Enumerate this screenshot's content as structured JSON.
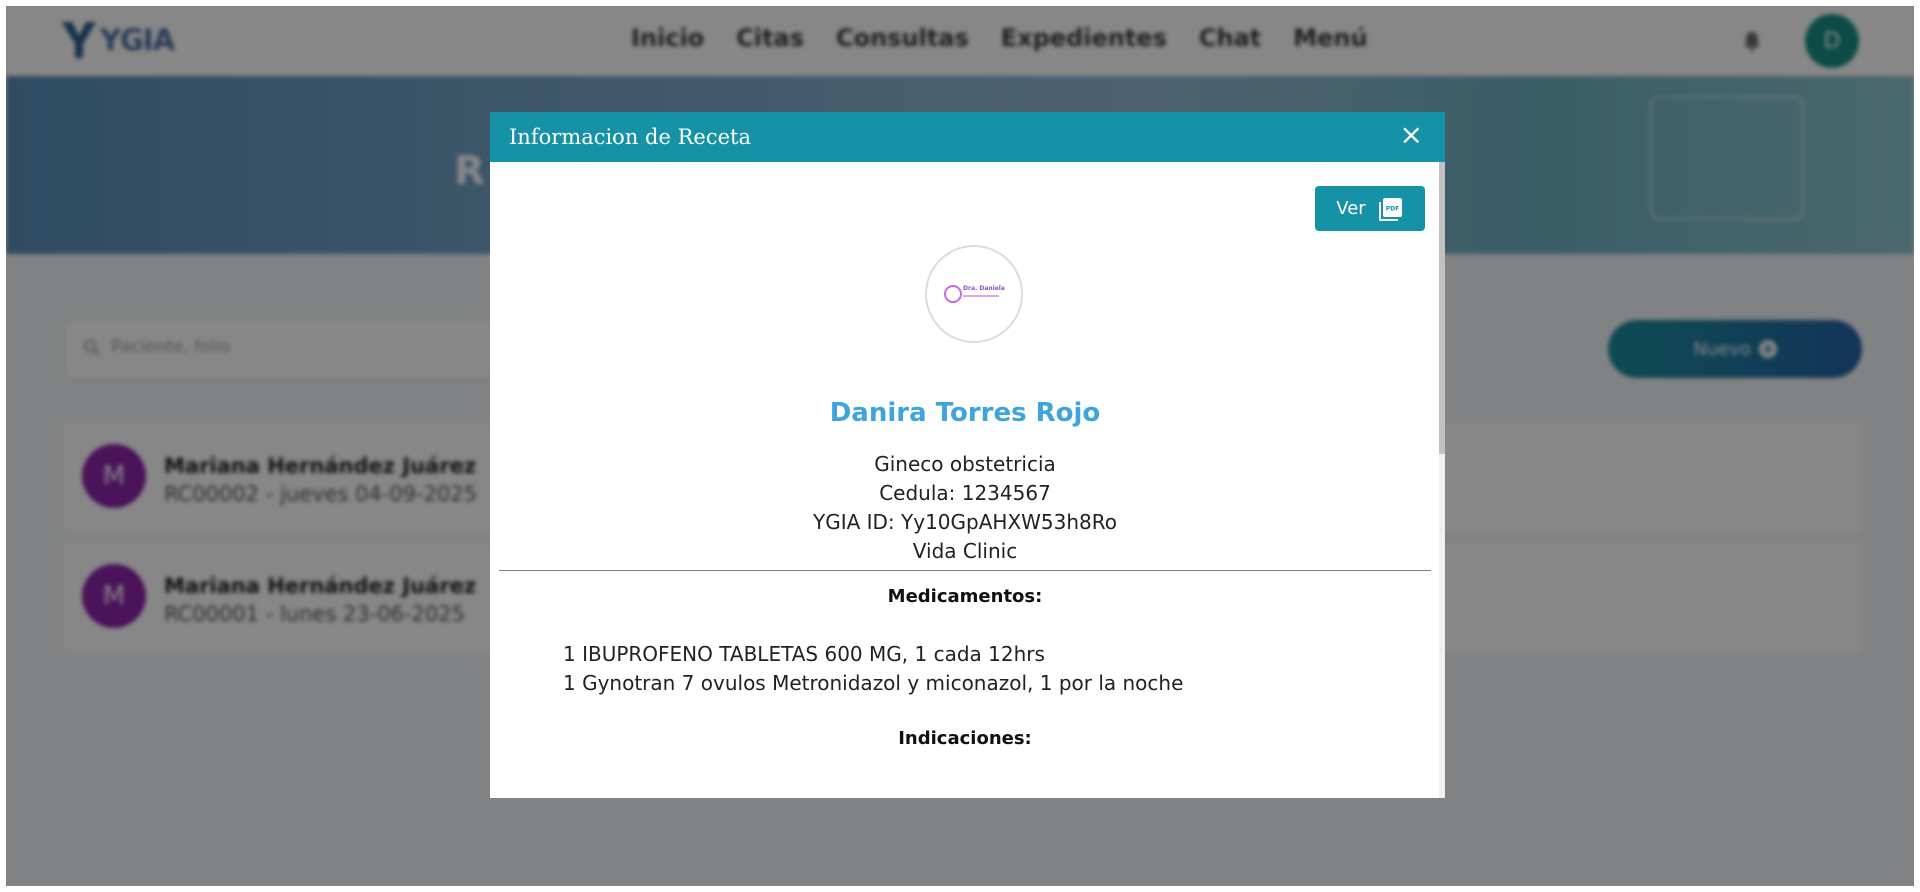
{
  "app": {
    "brand": "YGIA",
    "nav": [
      "Inicio",
      "Citas",
      "Consultas",
      "Expedientes",
      "Chat",
      "Menú"
    ],
    "user_initial": "D"
  },
  "page": {
    "title": "R",
    "search_placeholder": "Paciente, folio",
    "new_button_label": "Nuevo"
  },
  "prescriptions": [
    {
      "initial": "M",
      "patient": "Mariana Hernández Juárez",
      "detail": "RC00002 - jueves 04-09-2025"
    },
    {
      "initial": "M",
      "patient": "Mariana Hernández Juárez",
      "detail": "RC00001 - lunes 23-06-2025"
    }
  ],
  "modal": {
    "title": "Informacion de Receta",
    "close_symbol": "×",
    "view_button_label": "Ver",
    "clinic_logo_text": "Dra. Daniela",
    "doctor_name": "Danira Torres Rojo",
    "specialty": "Gineco obstetricia",
    "license": "Cedula: 1234567",
    "ygia_id": "YGIA ID: Yy10GpAHXW53h8Ro",
    "clinic": "Vida Clinic",
    "medications_title": "Medicamentos:",
    "medications": [
      "1 IBUPROFENO TABLETAS 600 MG, 1 cada 12hrs",
      "1 Gynotran 7 ovulos Metronidazol y miconazol, 1 por la noche"
    ],
    "indications_title": "Indicaciones:"
  },
  "colors": {
    "accent": "#1592a5",
    "doctor_name": "#3ea5dc",
    "avatar": "#8e24aa"
  }
}
